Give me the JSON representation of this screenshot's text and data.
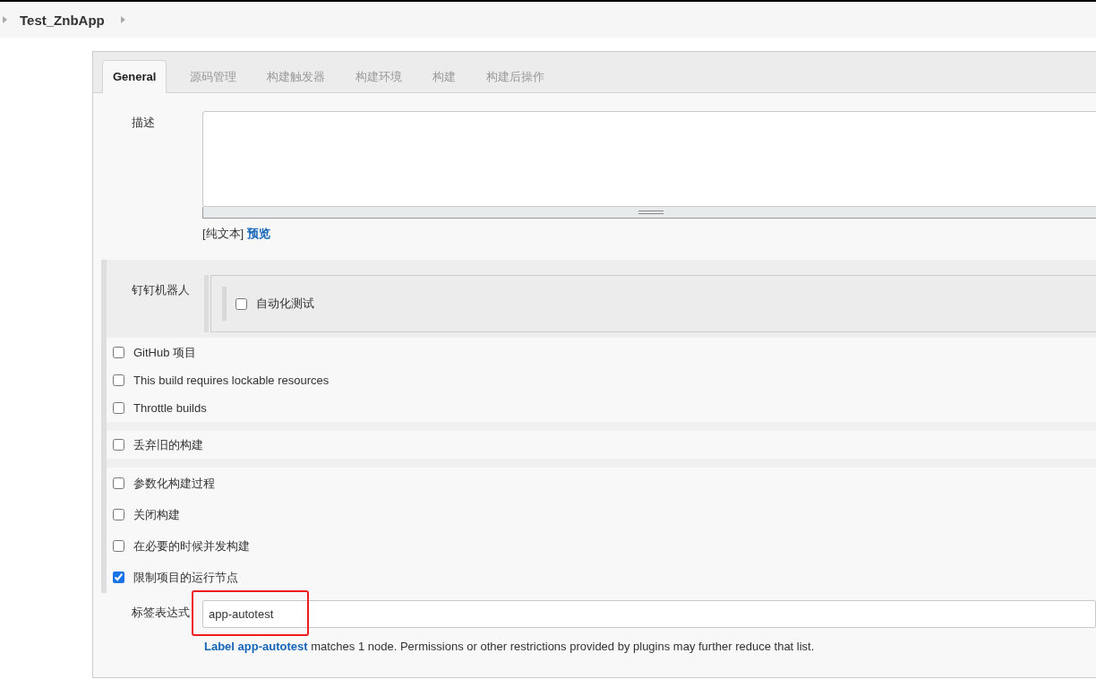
{
  "breadcrumb": [
    {
      "label": "Test_ZnbApp"
    }
  ],
  "tabs": [
    {
      "label": "General",
      "selected": true
    },
    {
      "label": "源码管理",
      "selected": false
    },
    {
      "label": "构建触发器",
      "selected": false
    },
    {
      "label": "构建环境",
      "selected": false
    },
    {
      "label": "构建",
      "selected": false
    },
    {
      "label": "构建后操作",
      "selected": false
    }
  ],
  "description": {
    "label": "描述",
    "plain_text": "[纯文本]",
    "preview_link": "预览"
  },
  "dingtalk": {
    "label": "钉钉机器人",
    "options": [
      {
        "label": "自动化测试",
        "checked": false
      }
    ]
  },
  "option_groups": [
    [
      {
        "label": "GitHub 项目",
        "checked": false
      },
      {
        "label": "This build requires lockable resources",
        "checked": false
      },
      {
        "label": "Throttle builds",
        "checked": false
      }
    ],
    [
      {
        "label": "丢弃旧的构建",
        "checked": false
      }
    ],
    [
      {
        "label": "参数化构建过程",
        "checked": false
      },
      {
        "label": "关闭构建",
        "checked": false
      },
      {
        "label": "在必要的时候并发构建",
        "checked": false
      },
      {
        "label": "限制项目的运行节点",
        "checked": true
      }
    ]
  ],
  "label_expression": {
    "label": "标签表达式",
    "value": "app-autotest",
    "highlighted": true,
    "help": "**Label app-autotest** matches 1 node. Permissions or other restrictions provided by plugins may further reduce that list."
  }
}
